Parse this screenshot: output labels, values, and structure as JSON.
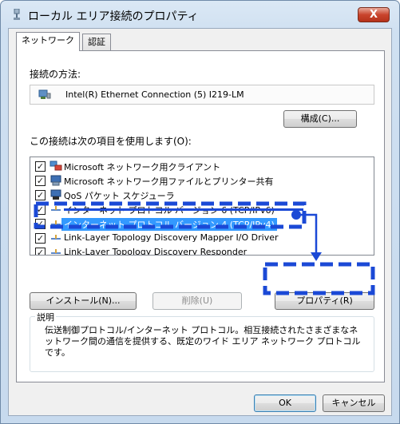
{
  "window": {
    "title": "ローカル エリア接続のプロパティ",
    "close_label": "X"
  },
  "tabs": [
    {
      "label": "ネットワーク",
      "active": true
    },
    {
      "label": "認証",
      "active": false
    }
  ],
  "connect_using": {
    "label": "接続の方法:",
    "adapter": "Intel(R) Ethernet Connection (5) I219-LM",
    "configure_button": "構成(C)..."
  },
  "items_section": {
    "label": "この接続は次の項目を使用します(O):",
    "items": [
      {
        "label": "Microsoft ネットワーク用クライアント",
        "checked": true,
        "icon": "network-client-icon"
      },
      {
        "label": "Microsoft ネットワーク用ファイルとプリンター共有",
        "checked": true,
        "icon": "file-printer-sharing-icon"
      },
      {
        "label": "QoS パケット スケジューラ",
        "checked": true,
        "icon": "qos-scheduler-icon"
      },
      {
        "label": "インターネット プロトコル バージョン 6 (TCP/IPv6)",
        "checked": true,
        "icon": "protocol-icon"
      },
      {
        "label": "インターネット プロトコル バージョン 4 (TCP/IPv4)",
        "checked": true,
        "selected": true,
        "icon": "protocol-icon"
      },
      {
        "label": "Link-Layer Topology Discovery Mapper I/O Driver",
        "checked": true,
        "icon": "protocol-icon"
      },
      {
        "label": "Link-Layer Topology Discovery Responder",
        "checked": true,
        "icon": "protocol-icon"
      }
    ]
  },
  "buttons": {
    "install": "インストール(N)...",
    "uninstall": "削除(U)",
    "properties": "プロパティ(R)",
    "ok": "OK",
    "cancel": "キャンセル"
  },
  "description": {
    "legend": "説明",
    "text": "伝送制御プロトコル/インターネット プロトコル。相互接続されたさまざまなネットワーク間の通信を提供する、既定のワイド エリア ネットワーク プロトコルです。"
  },
  "colors": {
    "annotation_blue": "#1b49d6",
    "selection_blue": "#3399ff"
  }
}
